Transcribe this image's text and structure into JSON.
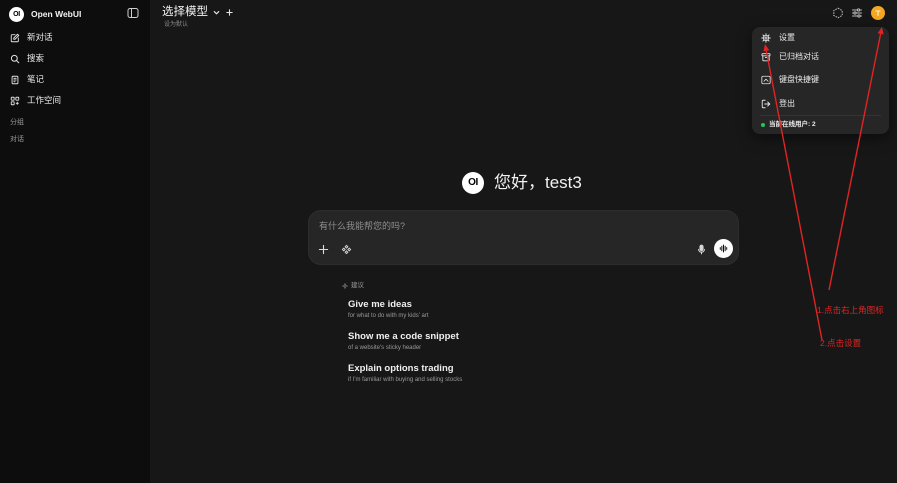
{
  "app": {
    "brand": "Open WebUI",
    "logo_text": "OI"
  },
  "sidebar": {
    "toggle_icon": "sidebar-toggle-icon",
    "items": [
      {
        "label": "新对话",
        "icon": "edit-icon"
      },
      {
        "label": "搜索",
        "icon": "search-icon"
      },
      {
        "label": "笔记",
        "icon": "notes-icon"
      },
      {
        "label": "工作空间",
        "icon": "workspace-icon"
      }
    ],
    "sections": {
      "groups": "分组",
      "chats": "对话"
    }
  },
  "header": {
    "model_selector": "选择模型",
    "set_default": "设为默认",
    "icons": [
      "chevron-down-icon",
      "plus-icon",
      "overview-icon",
      "sliders-icon",
      "user-avatar"
    ]
  },
  "user_menu": {
    "items": [
      {
        "label": "设置",
        "icon": "gear-icon"
      },
      {
        "label": "已归档对话",
        "icon": "archive-icon"
      },
      {
        "label": "键盘快捷键",
        "icon": "keyboard-icon"
      },
      {
        "label": "登出",
        "icon": "logout-icon"
      }
    ],
    "online_users": "当前在线用户: 2"
  },
  "greeting": {
    "logo_text": "OI",
    "text": "您好，test3"
  },
  "composer": {
    "placeholder": "有什么我能帮您的吗?",
    "icons": [
      "plus-icon",
      "tools-icon",
      "mic-icon",
      "voice-waveform-icon"
    ]
  },
  "suggestions": {
    "heading": "建议",
    "items": [
      {
        "title": "Give me ideas",
        "subtitle": "for what to do with my kids' art"
      },
      {
        "title": "Show me a code snippet",
        "subtitle": "of a website's sticky header"
      },
      {
        "title": "Explain options trading",
        "subtitle": "if I'm familiar with buying and selling stocks"
      }
    ]
  },
  "annotations": [
    {
      "text": "1.点击右上角图标"
    },
    {
      "text": "2.点击设置"
    }
  ],
  "colors": {
    "sidebar_bg": "#0d0d0d",
    "main_bg": "#171717",
    "menu_bg": "#262626",
    "avatar": "#f5a623",
    "online_dot": "#22c55e",
    "annotation_red": "#e02424"
  }
}
